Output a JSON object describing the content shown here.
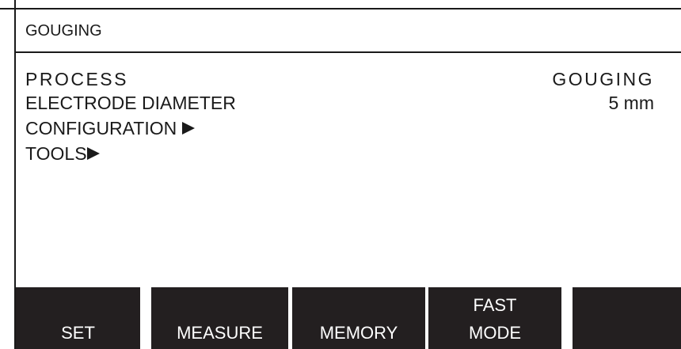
{
  "header": {
    "title": "GOUGING"
  },
  "menu": {
    "items": [
      {
        "label": "PROCESS",
        "value": "GOUGING"
      },
      {
        "label": "ELECTRODE DIAMETER",
        "value": "5 mm"
      },
      {
        "label": "CONFIGURATION",
        "submenu_icon": "right-triangle-icon"
      },
      {
        "label": "TOOLS",
        "submenu_icon": "right-triangle-icon"
      }
    ]
  },
  "softkeys": {
    "set": {
      "line1": "",
      "line2": "SET"
    },
    "measure": {
      "line1": "",
      "line2": "MEASURE"
    },
    "memory": {
      "line1": "",
      "line2": "MEMORY"
    },
    "fast_mode": {
      "line1": "FAST",
      "line2": "MODE"
    },
    "empty": {
      "line1": "",
      "line2": ""
    }
  },
  "colors": {
    "softkey_background": "#231f20",
    "softkey_text": "#ffffff",
    "text": "#1a1a1a",
    "background": "#ffffff"
  }
}
